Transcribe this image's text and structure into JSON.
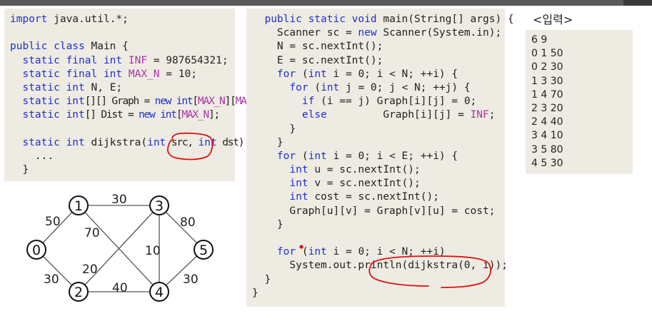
{
  "left_code": [
    [
      {
        "t": "import",
        "c": "kw"
      },
      {
        "t": " java.util.*;"
      }
    ],
    [],
    [
      {
        "t": "public class",
        "c": "kw"
      },
      {
        "t": " Main {"
      }
    ],
    [
      {
        "t": "  "
      },
      {
        "t": "static final int",
        "c": "kw"
      },
      {
        "t": " "
      },
      {
        "t": "INF",
        "c": "cn"
      },
      {
        "t": " = 987654321;"
      }
    ],
    [
      {
        "t": "  "
      },
      {
        "t": "static final int",
        "c": "kw"
      },
      {
        "t": " "
      },
      {
        "t": "MAX_N",
        "c": "cn"
      },
      {
        "t": " = 10;"
      }
    ],
    [
      {
        "t": "  "
      },
      {
        "t": "static int",
        "c": "kw"
      },
      {
        "t": " N, E;"
      }
    ],
    [
      {
        "t": "  "
      },
      {
        "t": "static int",
        "c": "kw"
      },
      {
        "t": "[][] Graph = ",
        "cl": "cond"
      },
      {
        "t": "new int",
        "c": "kw",
        "cl": "cond"
      },
      {
        "t": "[",
        "cl": "cond"
      },
      {
        "t": "MAX_N",
        "c": "cn",
        "cl": "cond"
      },
      {
        "t": "][",
        "cl": "cond"
      },
      {
        "t": "MAX_N",
        "c": "cn",
        "cl": "cond"
      },
      {
        "t": "];",
        "cl": "cond"
      }
    ],
    [
      {
        "t": "  "
      },
      {
        "t": "static int",
        "c": "kw"
      },
      {
        "t": "[] Dist = ",
        "cl": "cond"
      },
      {
        "t": "new int",
        "c": "kw",
        "cl": "cond"
      },
      {
        "t": "[",
        "cl": "cond"
      },
      {
        "t": "MAX_N",
        "c": "cn",
        "cl": "cond"
      },
      {
        "t": "];",
        "cl": "cond"
      }
    ],
    [],
    [
      {
        "t": "  "
      },
      {
        "t": "static int",
        "c": "kw"
      },
      {
        "t": " dijkstra("
      },
      {
        "t": "int",
        "c": "kw"
      },
      {
        "t": " src, ",
        "cl": "cond"
      },
      {
        "t": "int",
        "c": "kw"
      },
      {
        "t": " dst) {",
        "cl": "cond"
      }
    ],
    [
      {
        "t": "    ..."
      }
    ],
    [
      {
        "t": "  }"
      }
    ]
  ],
  "main_code": [
    [
      {
        "t": "  "
      },
      {
        "t": "public static void",
        "c": "kw"
      },
      {
        "t": " main(String[] args) {"
      }
    ],
    [
      {
        "t": "    Scanner sc = "
      },
      {
        "t": "new",
        "c": "kw"
      },
      {
        "t": " Scanner(System.in);"
      }
    ],
    [
      {
        "t": "    N = sc.nextInt();"
      }
    ],
    [
      {
        "t": "    E = sc.nextInt();"
      }
    ],
    [
      {
        "t": "    "
      },
      {
        "t": "for",
        "c": "kw"
      },
      {
        "t": " ("
      },
      {
        "t": "int",
        "c": "kw"
      },
      {
        "t": " i = 0; i < N; ++i) {"
      }
    ],
    [
      {
        "t": "      "
      },
      {
        "t": "for",
        "c": "kw"
      },
      {
        "t": " ("
      },
      {
        "t": "int",
        "c": "kw"
      },
      {
        "t": " j = 0; j < N; ++j) {"
      }
    ],
    [
      {
        "t": "        "
      },
      {
        "t": "if",
        "c": "kw"
      },
      {
        "t": " (i == j) Graph[i][j] = 0;"
      }
    ],
    [
      {
        "t": "        "
      },
      {
        "t": "else",
        "c": "kw"
      },
      {
        "t": "         Graph[i][j] = "
      },
      {
        "t": "INF",
        "c": "cn"
      },
      {
        "t": ";"
      }
    ],
    [
      {
        "t": "      }"
      }
    ],
    [
      {
        "t": "    }"
      }
    ],
    [
      {
        "t": "    "
      },
      {
        "t": "for",
        "c": "kw"
      },
      {
        "t": " ("
      },
      {
        "t": "int",
        "c": "kw"
      },
      {
        "t": " i = 0; i < E; ++i) {"
      }
    ],
    [
      {
        "t": "      "
      },
      {
        "t": "int",
        "c": "kw"
      },
      {
        "t": " u = sc.nextInt();"
      }
    ],
    [
      {
        "t": "      "
      },
      {
        "t": "int",
        "c": "kw"
      },
      {
        "t": " v = sc.nextInt();"
      }
    ],
    [
      {
        "t": "      "
      },
      {
        "t": "int",
        "c": "kw"
      },
      {
        "t": " cost = sc.nextInt();"
      }
    ],
    [
      {
        "t": "      Graph[u][v] = Graph[v][u] = cost;"
      }
    ],
    [
      {
        "t": "    }"
      }
    ],
    [],
    [
      {
        "t": "    "
      },
      {
        "t": "for",
        "c": "kw"
      },
      {
        "t": " ("
      },
      {
        "t": "int",
        "c": "kw"
      },
      {
        "t": " i = 0; i < N; ++i)"
      }
    ],
    [
      {
        "t": "      System.out.println(dijkstra(0, i));"
      }
    ],
    [
      {
        "t": "  }"
      }
    ],
    [
      {
        "t": "}"
      }
    ]
  ],
  "input": {
    "title": "<입력>",
    "lines": [
      "6 9",
      "0 1 50",
      "0 2 30",
      "1 3 30",
      "1 4 70",
      "2 3 20",
      "2 4 40",
      "3 4 10",
      "3 5 80",
      "4 5 30"
    ]
  },
  "graph": {
    "nodes": [
      "0",
      "1",
      "2",
      "3",
      "4",
      "5"
    ],
    "edges": [
      {
        "from": "0",
        "to": "1",
        "w": "50"
      },
      {
        "from": "0",
        "to": "2",
        "w": "30"
      },
      {
        "from": "1",
        "to": "3",
        "w": "30"
      },
      {
        "from": "1",
        "to": "4",
        "w": "70"
      },
      {
        "from": "2",
        "to": "3",
        "w": "20"
      },
      {
        "from": "2",
        "to": "4",
        "w": "40"
      },
      {
        "from": "3",
        "to": "4",
        "w": "10"
      },
      {
        "from": "3",
        "to": "5",
        "w": "80"
      },
      {
        "from": "4",
        "to": "5",
        "w": "30"
      }
    ]
  },
  "colors": {
    "keyword": "#1f2fd0",
    "constant": "#a637a6",
    "panel": "#eeebe2",
    "annotation": "#e01010"
  }
}
